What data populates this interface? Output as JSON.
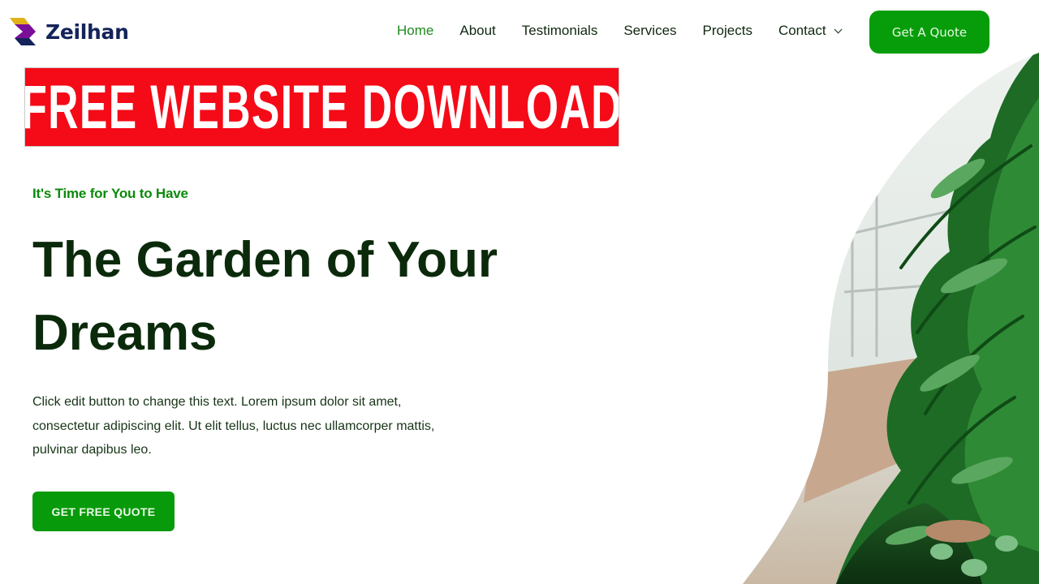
{
  "brand": {
    "name": "Zeilhan",
    "logo_icon": "zeilhan-logo-mark",
    "colors": {
      "logo_yellow": "#e0b21a",
      "logo_purple": "#7a0f9a",
      "logo_navy": "#14235a"
    }
  },
  "nav": {
    "items": [
      {
        "label": "Home",
        "active": true
      },
      {
        "label": "About",
        "active": false
      },
      {
        "label": "Testimonials",
        "active": false
      },
      {
        "label": "Services",
        "active": false
      },
      {
        "label": "Projects",
        "active": false
      },
      {
        "label": "Contact",
        "active": false,
        "has_dropdown": true,
        "icon": "chevron-down-icon"
      }
    ],
    "cta_label": "Get A Quote"
  },
  "banner": {
    "text": "FREE WEBSITE DOWNLOAD",
    "background": "#f50a17"
  },
  "hero": {
    "eyebrow": "It's Time for You to Have",
    "headline_line1": "The Garden of Your",
    "headline_line2": "Dreams",
    "body": "Click edit button to change this text. Lorem ipsum dolor sit amet, consectetur adipiscing elit. Ut elit tellus, luctus nec ullamcorper mattis, pulvinar dapibus leo.",
    "cta_label": "GET FREE QUOTE",
    "image_alt": "Indoor greenhouse garden with palms and leafy plants"
  },
  "colors": {
    "primary_green": "#079d0a",
    "accent_green": "#0a8a0a",
    "heading_dark_green": "#0b2a0b"
  }
}
